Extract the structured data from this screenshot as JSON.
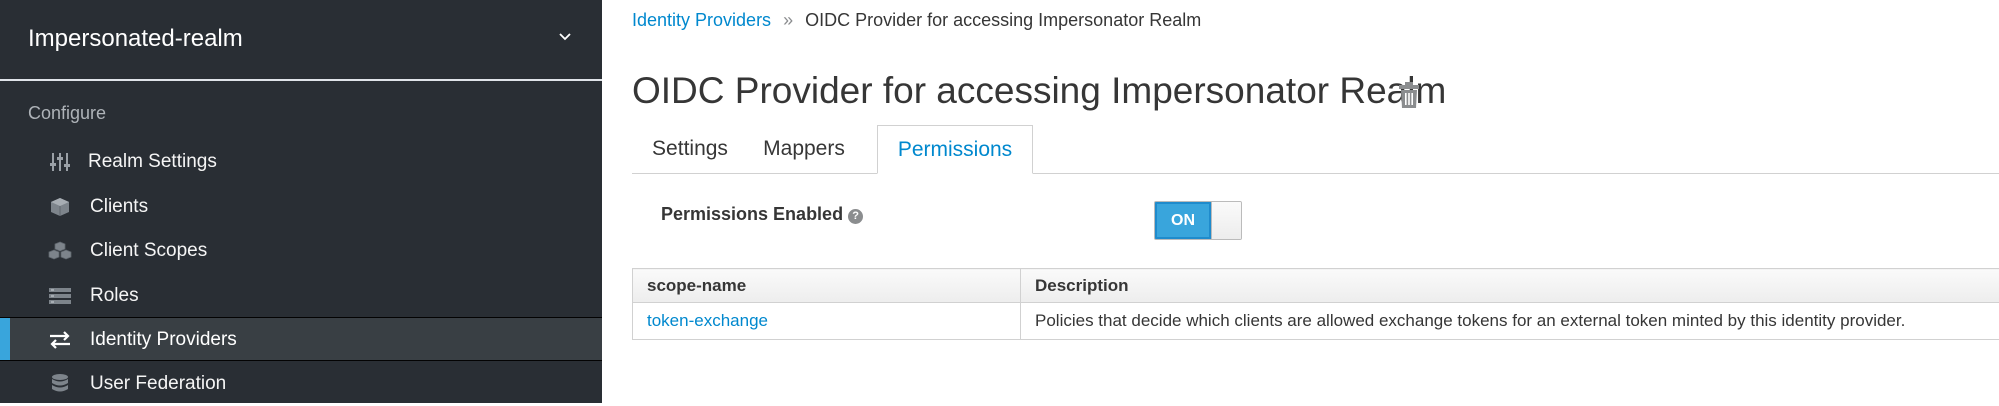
{
  "sidebar": {
    "realm_name": "Impersonated-realm",
    "section_label": "Configure",
    "items": [
      {
        "label": "Realm Settings",
        "icon": "sliders-icon"
      },
      {
        "label": "Clients",
        "icon": "cube-icon"
      },
      {
        "label": "Client Scopes",
        "icon": "cubes-icon"
      },
      {
        "label": "Roles",
        "icon": "list-icon"
      },
      {
        "label": "Identity Providers",
        "icon": "exchange-icon",
        "active": true
      },
      {
        "label": "User Federation",
        "icon": "database-icon"
      }
    ]
  },
  "breadcrumb": {
    "parent": "Identity Providers",
    "separator": "»",
    "current": "OIDC Provider for accessing Impersonator Realm"
  },
  "page": {
    "title": "OIDC Provider for accessing Impersonator Realm"
  },
  "tabs": [
    {
      "label": "Settings",
      "active": false
    },
    {
      "label": "Mappers",
      "active": false
    },
    {
      "label": "Permissions",
      "active": true
    }
  ],
  "permissions": {
    "enabled_label": "Permissions Enabled",
    "help_glyph": "?",
    "toggle_label": "ON"
  },
  "table": {
    "headers": [
      "scope-name",
      "Description"
    ],
    "rows": [
      {
        "scope": "token-exchange",
        "description": "Policies that decide which clients are allowed exchange tokens for an external token minted by this identity provider."
      }
    ]
  },
  "colors": {
    "sidebar_bg": "#292e34",
    "accent": "#39a5dc",
    "link": "#0088ce"
  }
}
